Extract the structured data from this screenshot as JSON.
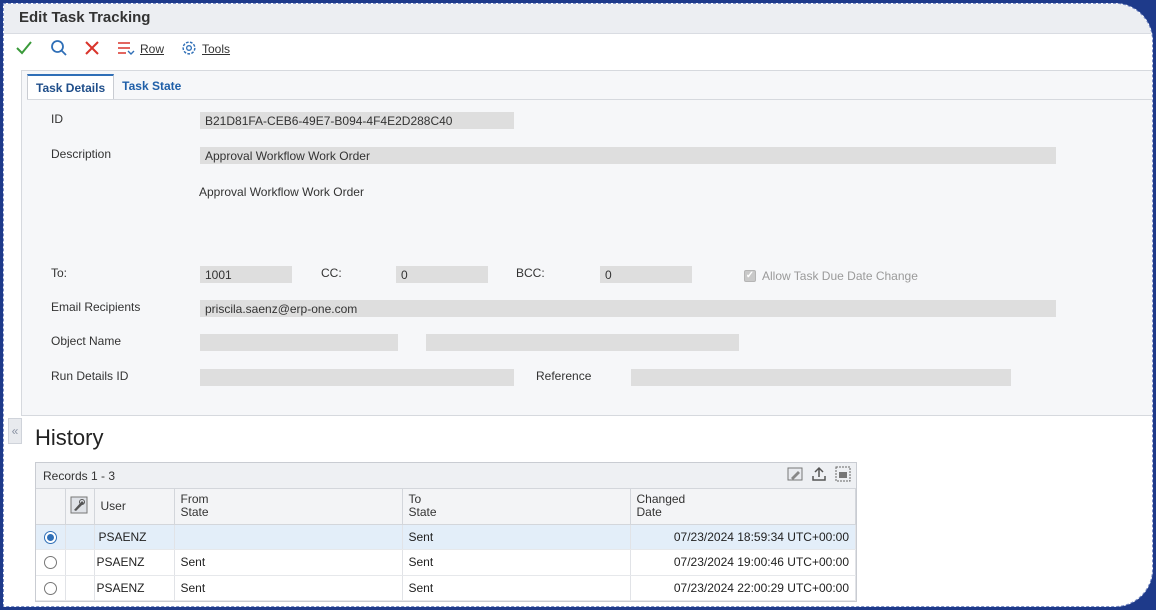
{
  "window": {
    "title": "Edit Task Tracking"
  },
  "toolbar": {
    "ok_icon": "check-icon",
    "search_icon": "search-icon",
    "cancel_icon": "close-icon",
    "row_label": "Row",
    "tools_label": "Tools"
  },
  "tabs": [
    {
      "label": "Task Details",
      "active": true
    },
    {
      "label": "Task State",
      "active": false
    }
  ],
  "form": {
    "id_label": "ID",
    "id_value": "B21D81FA-CEB6-49E7-B094-4F4E2D288C40",
    "description_label": "Description",
    "description_value": "Approval Workflow Work Order",
    "description_text": "Approval Workflow Work Order",
    "to_label": "To:",
    "to_value": "1001",
    "cc_label": "CC:",
    "cc_value": "0",
    "bcc_label": "BCC:",
    "bcc_value": "0",
    "allow_due_date_label": "Allow Task Due Date Change",
    "allow_due_date_checked": true,
    "email_label": "Email Recipients",
    "email_value": "priscila.saenz@erp-one.com",
    "object_name_label": "Object Name",
    "object_name_value": "",
    "object_name_value2": "",
    "run_details_label": "Run Details ID",
    "run_details_value": "",
    "reference_label": "Reference",
    "reference_value": ""
  },
  "history": {
    "title": "History",
    "records_label": "Records 1 - 3",
    "columns": {
      "user": "User",
      "from_state_1": "From",
      "from_state_2": "State",
      "to_state_1": "To",
      "to_state_2": "State",
      "changed_date_1": "Changed",
      "changed_date_2": "Date"
    },
    "rows": [
      {
        "user": "PSAENZ",
        "from_state": "",
        "to_state": "Sent",
        "changed_date": "07/23/2024 18:59:34 UTC+00:00",
        "selected": true
      },
      {
        "user": "PSAENZ",
        "from_state": "Sent",
        "to_state": "Sent",
        "changed_date": "07/23/2024 19:00:46 UTC+00:00",
        "selected": false
      },
      {
        "user": "PSAENZ",
        "from_state": "Sent",
        "to_state": "Sent",
        "changed_date": "07/23/2024 22:00:29 UTC+00:00",
        "selected": false
      }
    ]
  },
  "colors": {
    "accent": "#2f6fb7",
    "ok_green": "#3a9a3a",
    "cancel_red": "#d9342b",
    "field_gray": "#dedede"
  }
}
